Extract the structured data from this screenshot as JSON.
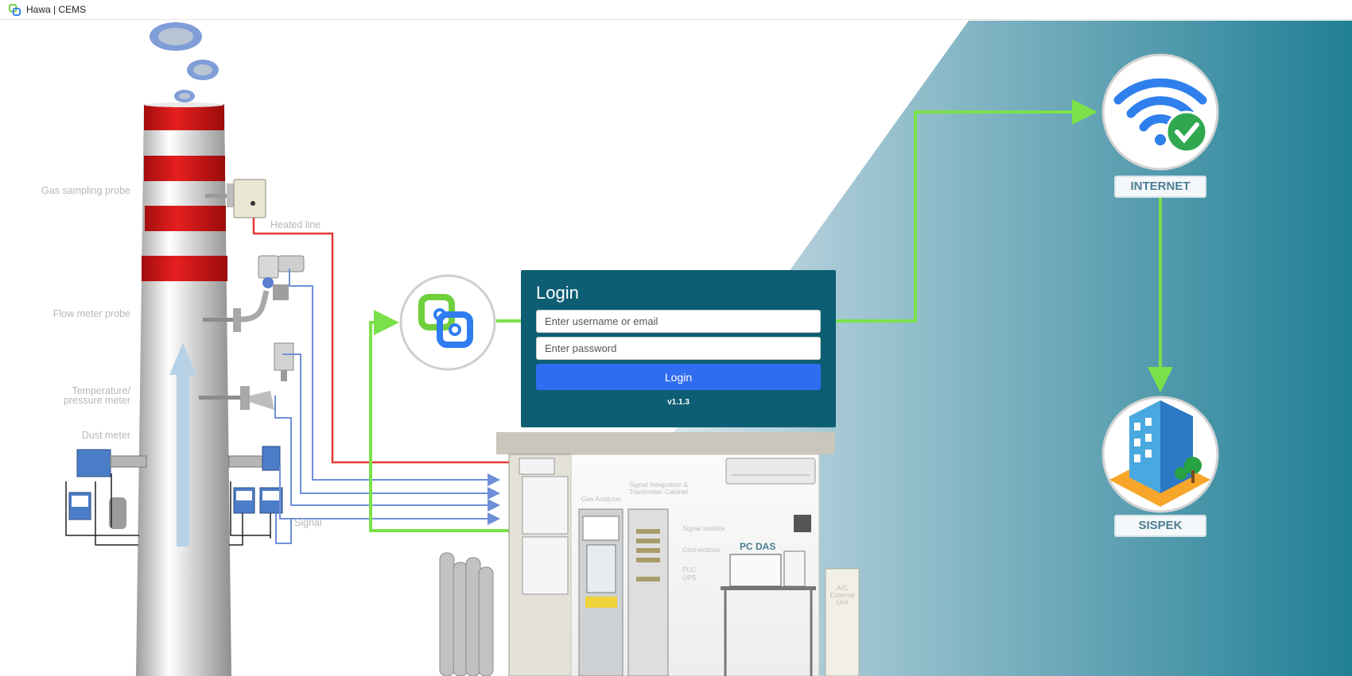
{
  "window": {
    "title": "Hawa | CEMS"
  },
  "login": {
    "title": "Login",
    "username_placeholder": "Enter username or email",
    "password_placeholder": "Enter password",
    "submit_label": "Login",
    "version": "v1.1.3"
  },
  "diagram": {
    "labels": {
      "gas_sampling_probe": "Gas sampling probe",
      "flow_meter_probe": "Flow meter probe",
      "temperature_pressure_meter": "Temperature/ pressure meter",
      "dust_meter": "Dust meter",
      "heated_line": "Heated line",
      "signal": "Signal",
      "gas_analyzer": "Gas Analyzer",
      "signal_cabinet": "Signal Integration & Transmitter Cabinet",
      "signal_isolator": "Signal Isolator",
      "connections": "Connections",
      "plc": "PLC",
      "ups": "UPS",
      "pc_das": "PC DAS",
      "ac_unit": "A/C External Unit"
    },
    "nodes": {
      "internet": "INTERNET",
      "sispek": "SISPEK"
    },
    "colors": {
      "heated_line": "#e53935",
      "signal": "#6f8fd8",
      "network": "#7be14a",
      "stack_red": "#dc1818",
      "panel": "#0e5e73",
      "button": "#2f6cf0"
    }
  }
}
